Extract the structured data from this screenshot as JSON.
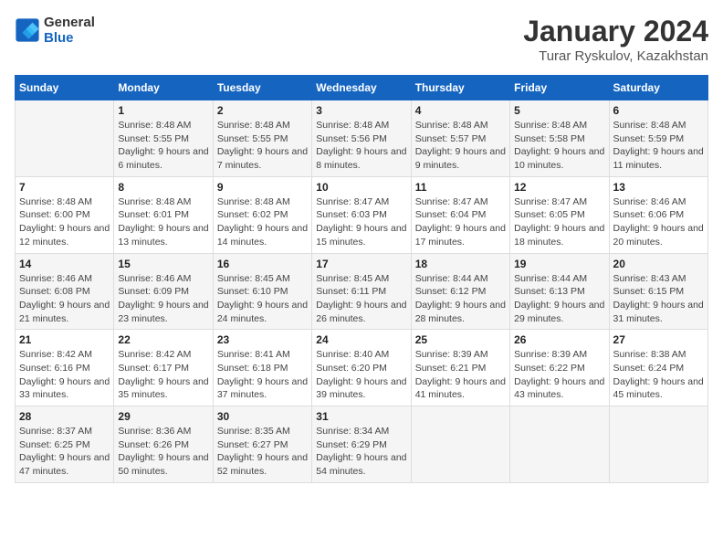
{
  "header": {
    "logo_line1": "General",
    "logo_line2": "Blue",
    "title": "January 2024",
    "subtitle": "Turar Ryskulov, Kazakhstan"
  },
  "weekdays": [
    "Sunday",
    "Monday",
    "Tuesday",
    "Wednesday",
    "Thursday",
    "Friday",
    "Saturday"
  ],
  "weeks": [
    [
      {
        "day": "",
        "sunrise": "",
        "sunset": "",
        "daylight": ""
      },
      {
        "day": "1",
        "sunrise": "Sunrise: 8:48 AM",
        "sunset": "Sunset: 5:55 PM",
        "daylight": "Daylight: 9 hours and 6 minutes."
      },
      {
        "day": "2",
        "sunrise": "Sunrise: 8:48 AM",
        "sunset": "Sunset: 5:55 PM",
        "daylight": "Daylight: 9 hours and 7 minutes."
      },
      {
        "day": "3",
        "sunrise": "Sunrise: 8:48 AM",
        "sunset": "Sunset: 5:56 PM",
        "daylight": "Daylight: 9 hours and 8 minutes."
      },
      {
        "day": "4",
        "sunrise": "Sunrise: 8:48 AM",
        "sunset": "Sunset: 5:57 PM",
        "daylight": "Daylight: 9 hours and 9 minutes."
      },
      {
        "day": "5",
        "sunrise": "Sunrise: 8:48 AM",
        "sunset": "Sunset: 5:58 PM",
        "daylight": "Daylight: 9 hours and 10 minutes."
      },
      {
        "day": "6",
        "sunrise": "Sunrise: 8:48 AM",
        "sunset": "Sunset: 5:59 PM",
        "daylight": "Daylight: 9 hours and 11 minutes."
      }
    ],
    [
      {
        "day": "7",
        "sunrise": "Sunrise: 8:48 AM",
        "sunset": "Sunset: 6:00 PM",
        "daylight": "Daylight: 9 hours and 12 minutes."
      },
      {
        "day": "8",
        "sunrise": "Sunrise: 8:48 AM",
        "sunset": "Sunset: 6:01 PM",
        "daylight": "Daylight: 9 hours and 13 minutes."
      },
      {
        "day": "9",
        "sunrise": "Sunrise: 8:48 AM",
        "sunset": "Sunset: 6:02 PM",
        "daylight": "Daylight: 9 hours and 14 minutes."
      },
      {
        "day": "10",
        "sunrise": "Sunrise: 8:47 AM",
        "sunset": "Sunset: 6:03 PM",
        "daylight": "Daylight: 9 hours and 15 minutes."
      },
      {
        "day": "11",
        "sunrise": "Sunrise: 8:47 AM",
        "sunset": "Sunset: 6:04 PM",
        "daylight": "Daylight: 9 hours and 17 minutes."
      },
      {
        "day": "12",
        "sunrise": "Sunrise: 8:47 AM",
        "sunset": "Sunset: 6:05 PM",
        "daylight": "Daylight: 9 hours and 18 minutes."
      },
      {
        "day": "13",
        "sunrise": "Sunrise: 8:46 AM",
        "sunset": "Sunset: 6:06 PM",
        "daylight": "Daylight: 9 hours and 20 minutes."
      }
    ],
    [
      {
        "day": "14",
        "sunrise": "Sunrise: 8:46 AM",
        "sunset": "Sunset: 6:08 PM",
        "daylight": "Daylight: 9 hours and 21 minutes."
      },
      {
        "day": "15",
        "sunrise": "Sunrise: 8:46 AM",
        "sunset": "Sunset: 6:09 PM",
        "daylight": "Daylight: 9 hours and 23 minutes."
      },
      {
        "day": "16",
        "sunrise": "Sunrise: 8:45 AM",
        "sunset": "Sunset: 6:10 PM",
        "daylight": "Daylight: 9 hours and 24 minutes."
      },
      {
        "day": "17",
        "sunrise": "Sunrise: 8:45 AM",
        "sunset": "Sunset: 6:11 PM",
        "daylight": "Daylight: 9 hours and 26 minutes."
      },
      {
        "day": "18",
        "sunrise": "Sunrise: 8:44 AM",
        "sunset": "Sunset: 6:12 PM",
        "daylight": "Daylight: 9 hours and 28 minutes."
      },
      {
        "day": "19",
        "sunrise": "Sunrise: 8:44 AM",
        "sunset": "Sunset: 6:13 PM",
        "daylight": "Daylight: 9 hours and 29 minutes."
      },
      {
        "day": "20",
        "sunrise": "Sunrise: 8:43 AM",
        "sunset": "Sunset: 6:15 PM",
        "daylight": "Daylight: 9 hours and 31 minutes."
      }
    ],
    [
      {
        "day": "21",
        "sunrise": "Sunrise: 8:42 AM",
        "sunset": "Sunset: 6:16 PM",
        "daylight": "Daylight: 9 hours and 33 minutes."
      },
      {
        "day": "22",
        "sunrise": "Sunrise: 8:42 AM",
        "sunset": "Sunset: 6:17 PM",
        "daylight": "Daylight: 9 hours and 35 minutes."
      },
      {
        "day": "23",
        "sunrise": "Sunrise: 8:41 AM",
        "sunset": "Sunset: 6:18 PM",
        "daylight": "Daylight: 9 hours and 37 minutes."
      },
      {
        "day": "24",
        "sunrise": "Sunrise: 8:40 AM",
        "sunset": "Sunset: 6:20 PM",
        "daylight": "Daylight: 9 hours and 39 minutes."
      },
      {
        "day": "25",
        "sunrise": "Sunrise: 8:39 AM",
        "sunset": "Sunset: 6:21 PM",
        "daylight": "Daylight: 9 hours and 41 minutes."
      },
      {
        "day": "26",
        "sunrise": "Sunrise: 8:39 AM",
        "sunset": "Sunset: 6:22 PM",
        "daylight": "Daylight: 9 hours and 43 minutes."
      },
      {
        "day": "27",
        "sunrise": "Sunrise: 8:38 AM",
        "sunset": "Sunset: 6:24 PM",
        "daylight": "Daylight: 9 hours and 45 minutes."
      }
    ],
    [
      {
        "day": "28",
        "sunrise": "Sunrise: 8:37 AM",
        "sunset": "Sunset: 6:25 PM",
        "daylight": "Daylight: 9 hours and 47 minutes."
      },
      {
        "day": "29",
        "sunrise": "Sunrise: 8:36 AM",
        "sunset": "Sunset: 6:26 PM",
        "daylight": "Daylight: 9 hours and 50 minutes."
      },
      {
        "day": "30",
        "sunrise": "Sunrise: 8:35 AM",
        "sunset": "Sunset: 6:27 PM",
        "daylight": "Daylight: 9 hours and 52 minutes."
      },
      {
        "day": "31",
        "sunrise": "Sunrise: 8:34 AM",
        "sunset": "Sunset: 6:29 PM",
        "daylight": "Daylight: 9 hours and 54 minutes."
      },
      {
        "day": "",
        "sunrise": "",
        "sunset": "",
        "daylight": ""
      },
      {
        "day": "",
        "sunrise": "",
        "sunset": "",
        "daylight": ""
      },
      {
        "day": "",
        "sunrise": "",
        "sunset": "",
        "daylight": ""
      }
    ]
  ]
}
